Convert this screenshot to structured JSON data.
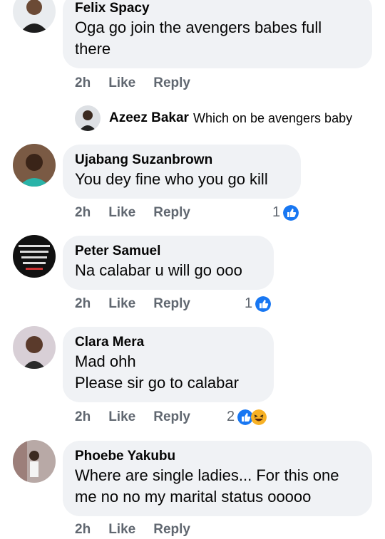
{
  "comments": [
    {
      "author": "Felix Spacy",
      "lines": [
        "Oga go join the avengers babes full",
        "there"
      ],
      "time": "2h",
      "like": "Like",
      "reply": "Reply"
    },
    {
      "author": "Ujabang Suzanbrown",
      "lines": [
        "You dey fine who you go kill"
      ],
      "time": "2h",
      "like": "Like",
      "reply": "Reply",
      "reaction_count": "1"
    },
    {
      "author": "Peter Samuel",
      "lines": [
        "Na calabar u will go ooo"
      ],
      "time": "2h",
      "like": "Like",
      "reply": "Reply",
      "reaction_count": "1"
    },
    {
      "author": "Clara Mera",
      "lines": [
        "Mad ohh",
        "Please sir go to calabar"
      ],
      "time": "2h",
      "like": "Like",
      "reply": "Reply",
      "reaction_count": "2"
    },
    {
      "author": "Phoebe Yakubu",
      "lines": [
        "Where are single ladies... For this one",
        "me no no my marital status ooooo"
      ],
      "time": "2h",
      "like": "Like",
      "reply": "Reply"
    }
  ],
  "reply_preview": {
    "author": "Azeez Bakar",
    "text": "Which on be avengers baby"
  },
  "colors": {
    "bubble": "#f0f2f5",
    "meta": "#606770",
    "like_blue": "#1877f2",
    "haha_yellow": "#f7b125"
  },
  "icons": {
    "like": "thumbs-up-icon",
    "haha": "laughing-face-icon"
  }
}
